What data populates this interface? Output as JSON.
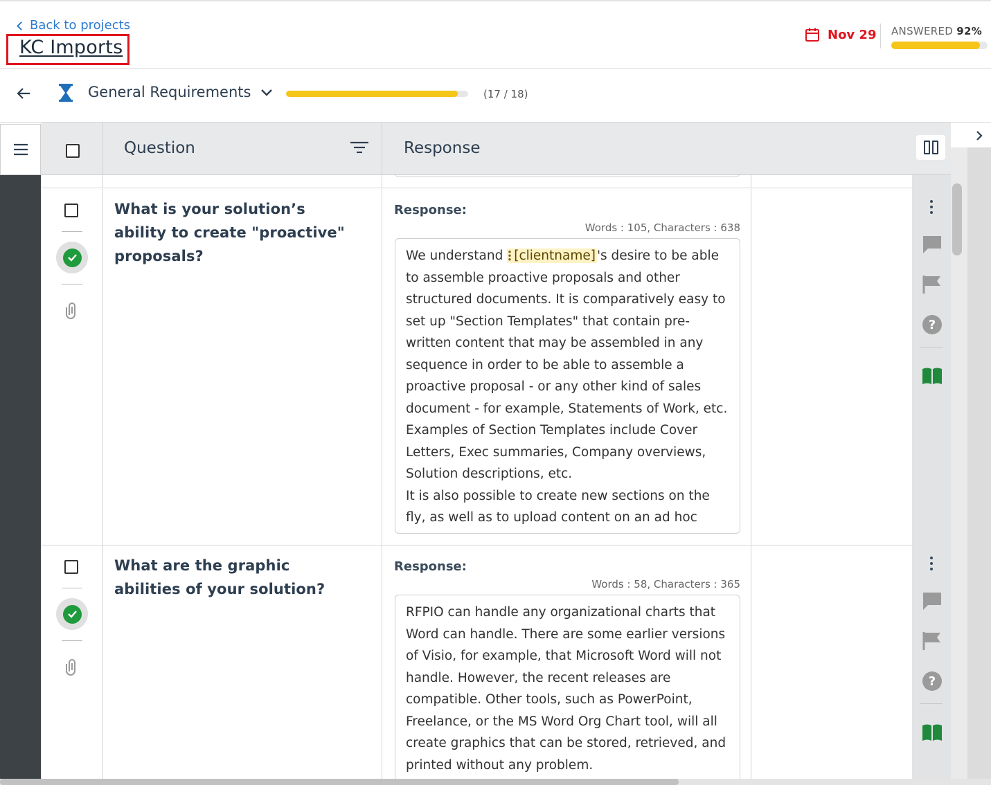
{
  "header": {
    "back_label": "Back to projects",
    "project_title": "KC Imports",
    "due_date": "Nov 29",
    "answered_label": "ANSWERED",
    "answered_percent": "92%",
    "answered_fraction": 0.92,
    "colors": {
      "accent": "#2b7bd0",
      "danger": "#e0141e",
      "progress": "#f5c518",
      "success": "#1f9a3c"
    }
  },
  "section": {
    "title": "General Requirements",
    "progress_text": "(17 / 18)",
    "progress_fraction": 0.944
  },
  "grid": {
    "columns": {
      "question": "Question",
      "response": "Response"
    },
    "icons": {
      "menu": "hamburger-icon",
      "filter": "filter-icon",
      "split_view": "split-columns-icon",
      "expand": "chevron-right-icon"
    }
  },
  "rows": [
    {
      "question": "What is your solution’s ability to create \"proactive\" proposals?",
      "response_label": "Response:",
      "word_count": "Words : 105, Characters : 638",
      "response_before": "We understand ",
      "response_token": "[clientname]",
      "response_after": "'s desire to be able to assemble proactive proposals and other structured documents. It is comparatively easy to set up \"Section Templates\" that contain pre-written content that may be assembled in any sequence in order to be able to assemble a proactive proposal - or any other kind of sales document - for example, Statements of Work, etc. Examples of Section Templates include Cover Letters, Exec summaries, Company overviews, Solution descriptions, etc.",
      "response_line2": "It is also possible to create new sections on the fly, as well as to upload content on an ad hoc basis, in order to tailor the response for the customer.",
      "status": "complete"
    },
    {
      "question": "What are the graphic abilities of your solution?",
      "response_label": "Response:",
      "word_count": "Words : 58, Characters : 365",
      "response_text": "RFPIO can handle any organizational charts that Word can handle. There are some earlier versions of Visio, for example, that Microsoft Word will not handle. However, the recent releases are compatible. Other tools, such as PowerPoint, Freelance, or the MS Word Org Chart tool, will all create graphics that can be stored, retrieved, and printed without any problem.",
      "status": "complete"
    }
  ]
}
